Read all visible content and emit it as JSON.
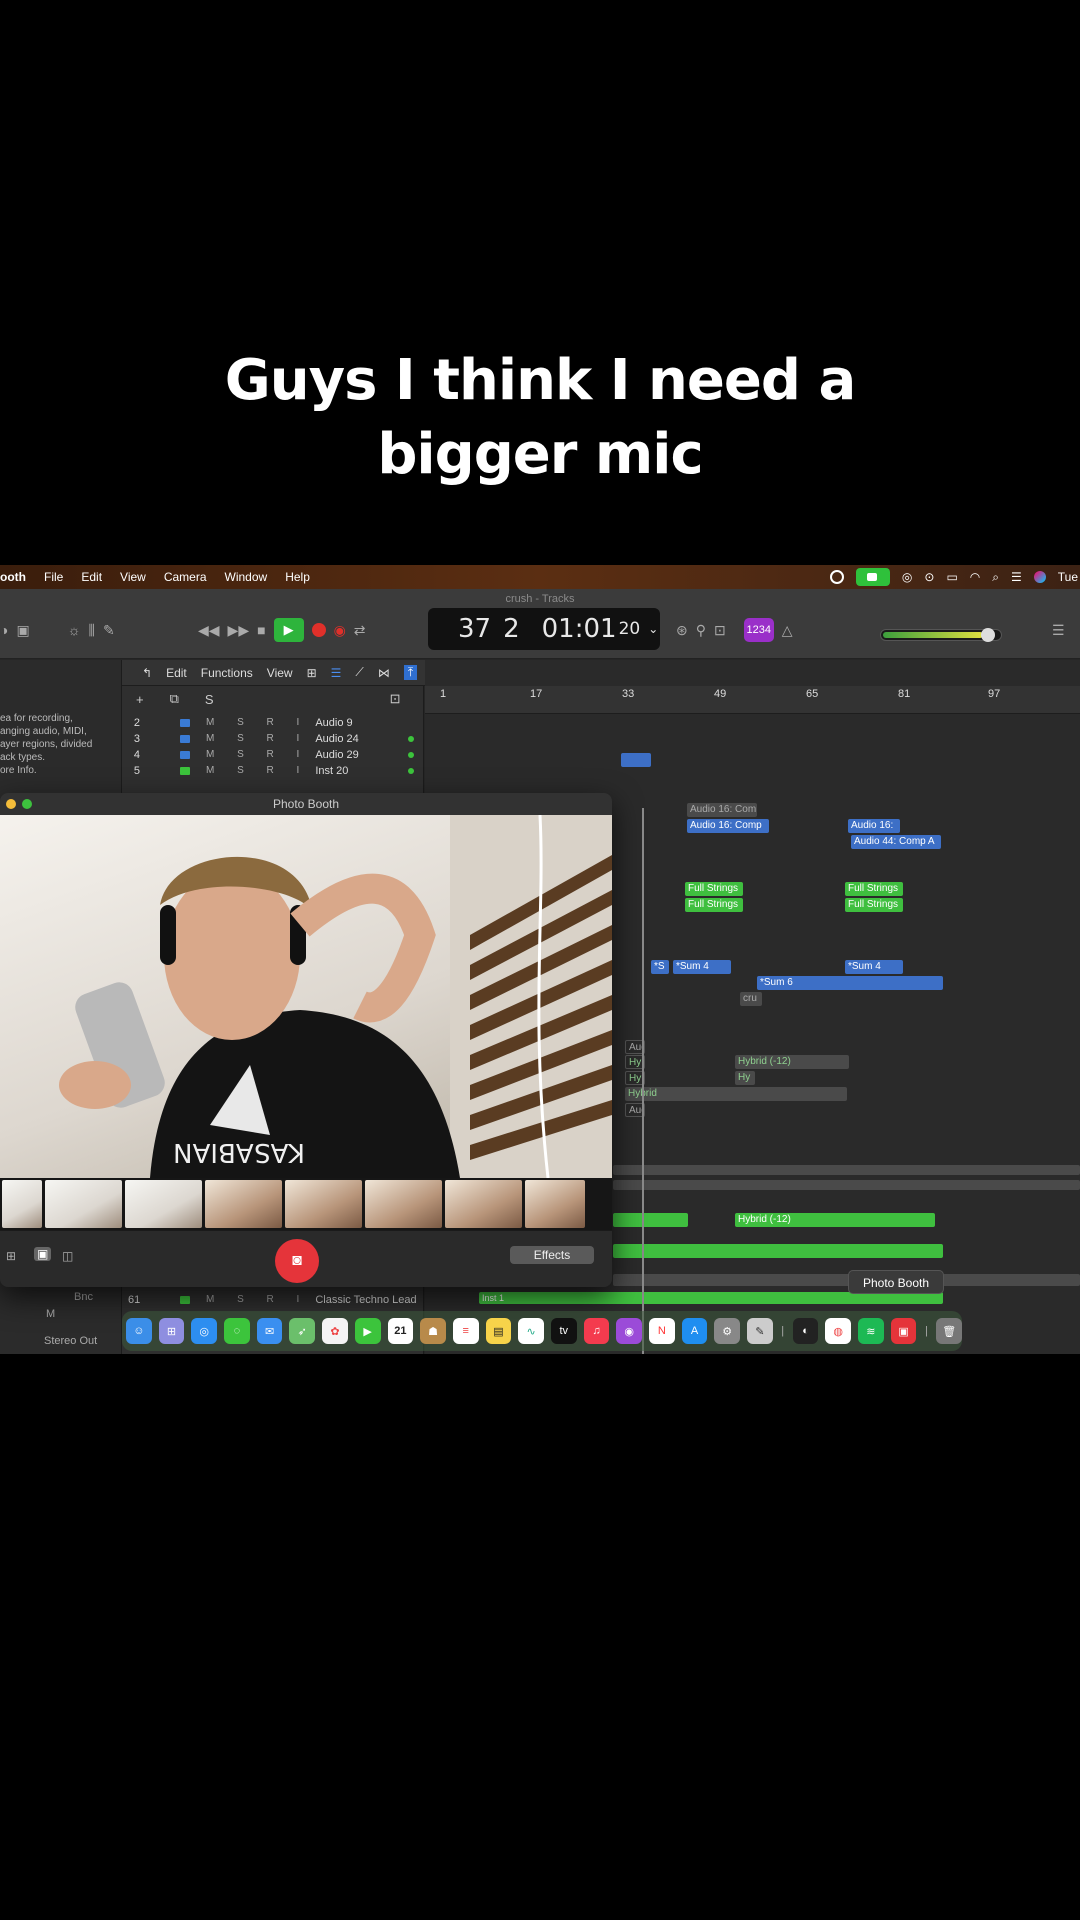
{
  "caption": {
    "line1": "Guys I think I need a",
    "line2": "bigger mic"
  },
  "menubar": {
    "app": "ooth",
    "items": [
      "File",
      "Edit",
      "View",
      "Camera",
      "Window",
      "Help"
    ],
    "clock": "Tue"
  },
  "logic": {
    "window_title": "crush - Tracks",
    "lcd": {
      "bar": "37",
      "beat": "2",
      "time": "01:01",
      "frames": "20"
    },
    "count_in": "1234",
    "edit_menu": [
      "Edit",
      "Functions",
      "View"
    ],
    "header_buttons": [
      "+",
      "S"
    ],
    "inspector_text": [
      "ea for recording,",
      "anging audio, MIDI,",
      "ayer regions, divided",
      "ack types.",
      "ore Info."
    ],
    "ruler": [
      "1",
      "17",
      "33",
      "49",
      "65",
      "81",
      "97"
    ],
    "tracks": [
      {
        "num": "2",
        "ms": "M S R I",
        "name": "Audio 9"
      },
      {
        "num": "3",
        "ms": "M S R I",
        "name": "Audio 24"
      },
      {
        "num": "4",
        "ms": "M S R I",
        "name": "Audio 29"
      },
      {
        "num": "5",
        "ms": "M S R I",
        "name": "Inst 20"
      }
    ],
    "regions": {
      "audio16comp_a": "Audio 16: Com",
      "audio16comp_b": "Audio 16: Comp",
      "audio16_c": "Audio 16:",
      "audio44": "Audio 44: Comp A",
      "strings1": "Full Strings",
      "strings2": "Full Strings",
      "strings3": "Full Strings",
      "strings4": "Full Strings",
      "sum4a": "*Sum 4",
      "sum4b": "*Sum 4",
      "sum6": "*Sum 6",
      "s_short": "*S",
      "hybrid12": "Hybrid (-12)",
      "hy1": "Hy",
      "hy2": "Hy",
      "hybrid": "Hybrid",
      "hybrid12b": "Hybrid (-12)",
      "aud1": "Aud",
      "aud2": "Aud",
      "cru": "cru",
      "inst1": "Inst 1"
    },
    "bottom_track": {
      "name": "Bnc",
      "num": "61",
      "ms": "M S R I",
      "inst": "Classic Techno Lead"
    },
    "left_labels": {
      "m": "M",
      "stereo_out": "Stereo Out"
    }
  },
  "photobooth": {
    "title": "Photo Booth",
    "effects_label": "Effects",
    "shirt_text": "KASABIAN"
  },
  "dock": {
    "tooltip": "Photo Booth",
    "calendar_day": "21",
    "tv_label": "tv"
  },
  "colors": {
    "accent_green": "#2fc13b",
    "record_red": "#e5343a",
    "region_blue": "#3d6fc6",
    "region_green": "#3fbf3f"
  }
}
